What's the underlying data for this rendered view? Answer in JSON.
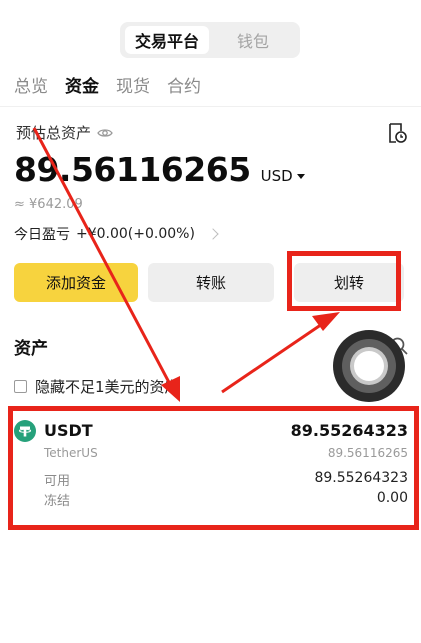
{
  "header": {
    "segments": [
      {
        "label": "交易平台",
        "active": true
      },
      {
        "label": "钱包",
        "active": false
      }
    ]
  },
  "tabs": [
    {
      "label": "总览",
      "active": false
    },
    {
      "label": "资金",
      "active": true
    },
    {
      "label": "现货",
      "active": false
    },
    {
      "label": "合约",
      "active": false
    }
  ],
  "summary": {
    "estimated_label": "预估总资产",
    "balance": "89.56116265",
    "currency": "USD",
    "cny_equivalent": "≈ ¥642.09",
    "pnl_label": "今日盈亏",
    "pnl_value": "+¥0.00(+0.00%)"
  },
  "actions": {
    "add_funds": "添加资金",
    "transfer": "转账",
    "move": "划转"
  },
  "assets": {
    "title": "资产",
    "hide_small_label": "隐藏不足1美元的资产",
    "items": [
      {
        "symbol": "USDT",
        "name": "TetherUS",
        "total": "89.55264323",
        "fiat_value": "89.56116265",
        "available_label": "可用",
        "available": "89.55264323",
        "frozen_label": "冻结",
        "frozen": "0.00"
      }
    ]
  },
  "colors": {
    "accent_yellow": "#f7d33e",
    "annotation_red": "#e8241a",
    "tether_green": "#26a17b"
  },
  "icons": [
    "eye-icon",
    "history-icon",
    "caret-down-icon",
    "chevron-right-icon",
    "search-icon",
    "tether-icon",
    "assistive-touch-icon"
  ]
}
